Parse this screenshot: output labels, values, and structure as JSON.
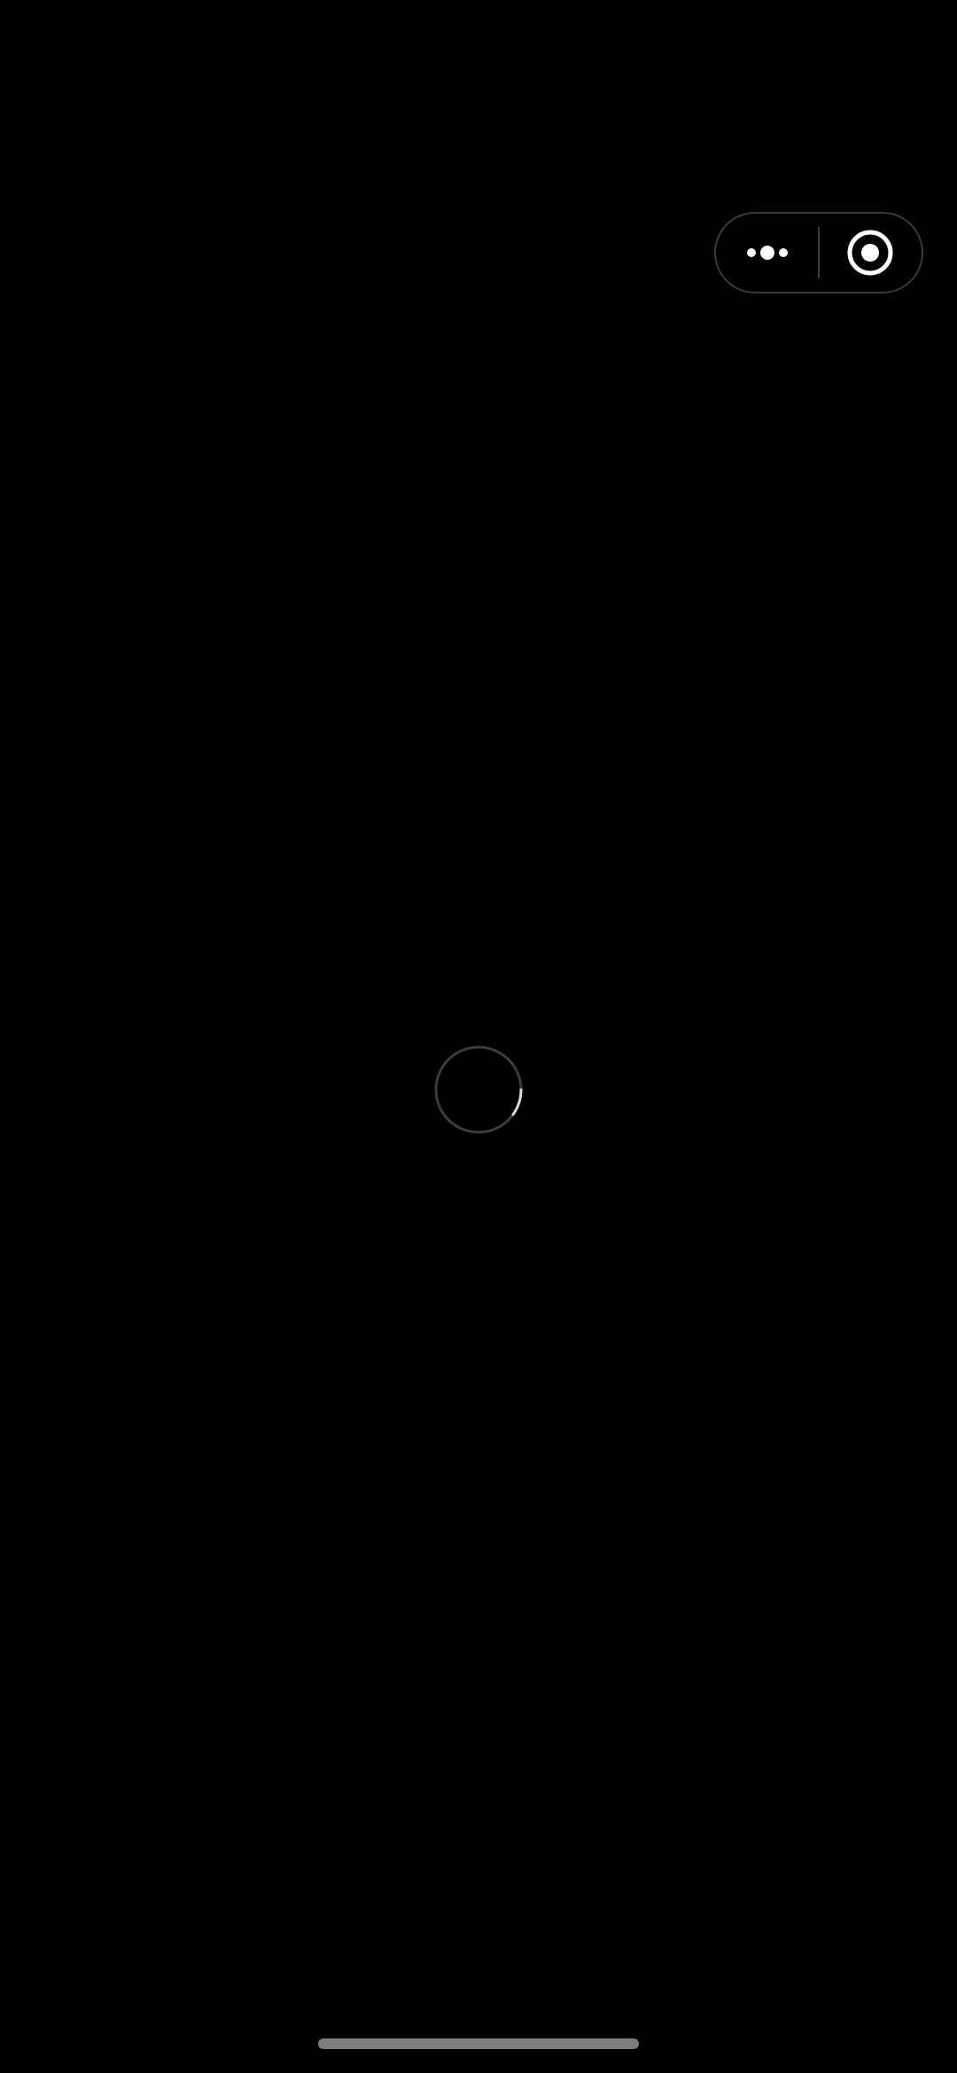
{
  "screen": {
    "background": "#000000",
    "state": "loading"
  },
  "capsule": {
    "more_icon": "more-dots-icon",
    "close_icon": "close-target-icon",
    "border_color": "#3a3a3a",
    "icon_color": "#ffffff"
  },
  "loader": {
    "icon": "loading-spinner-icon",
    "track_color": "#3c3c3c",
    "arc_color": "#d9d9d9"
  },
  "home_indicator": {
    "color": "#7d7d7d"
  }
}
